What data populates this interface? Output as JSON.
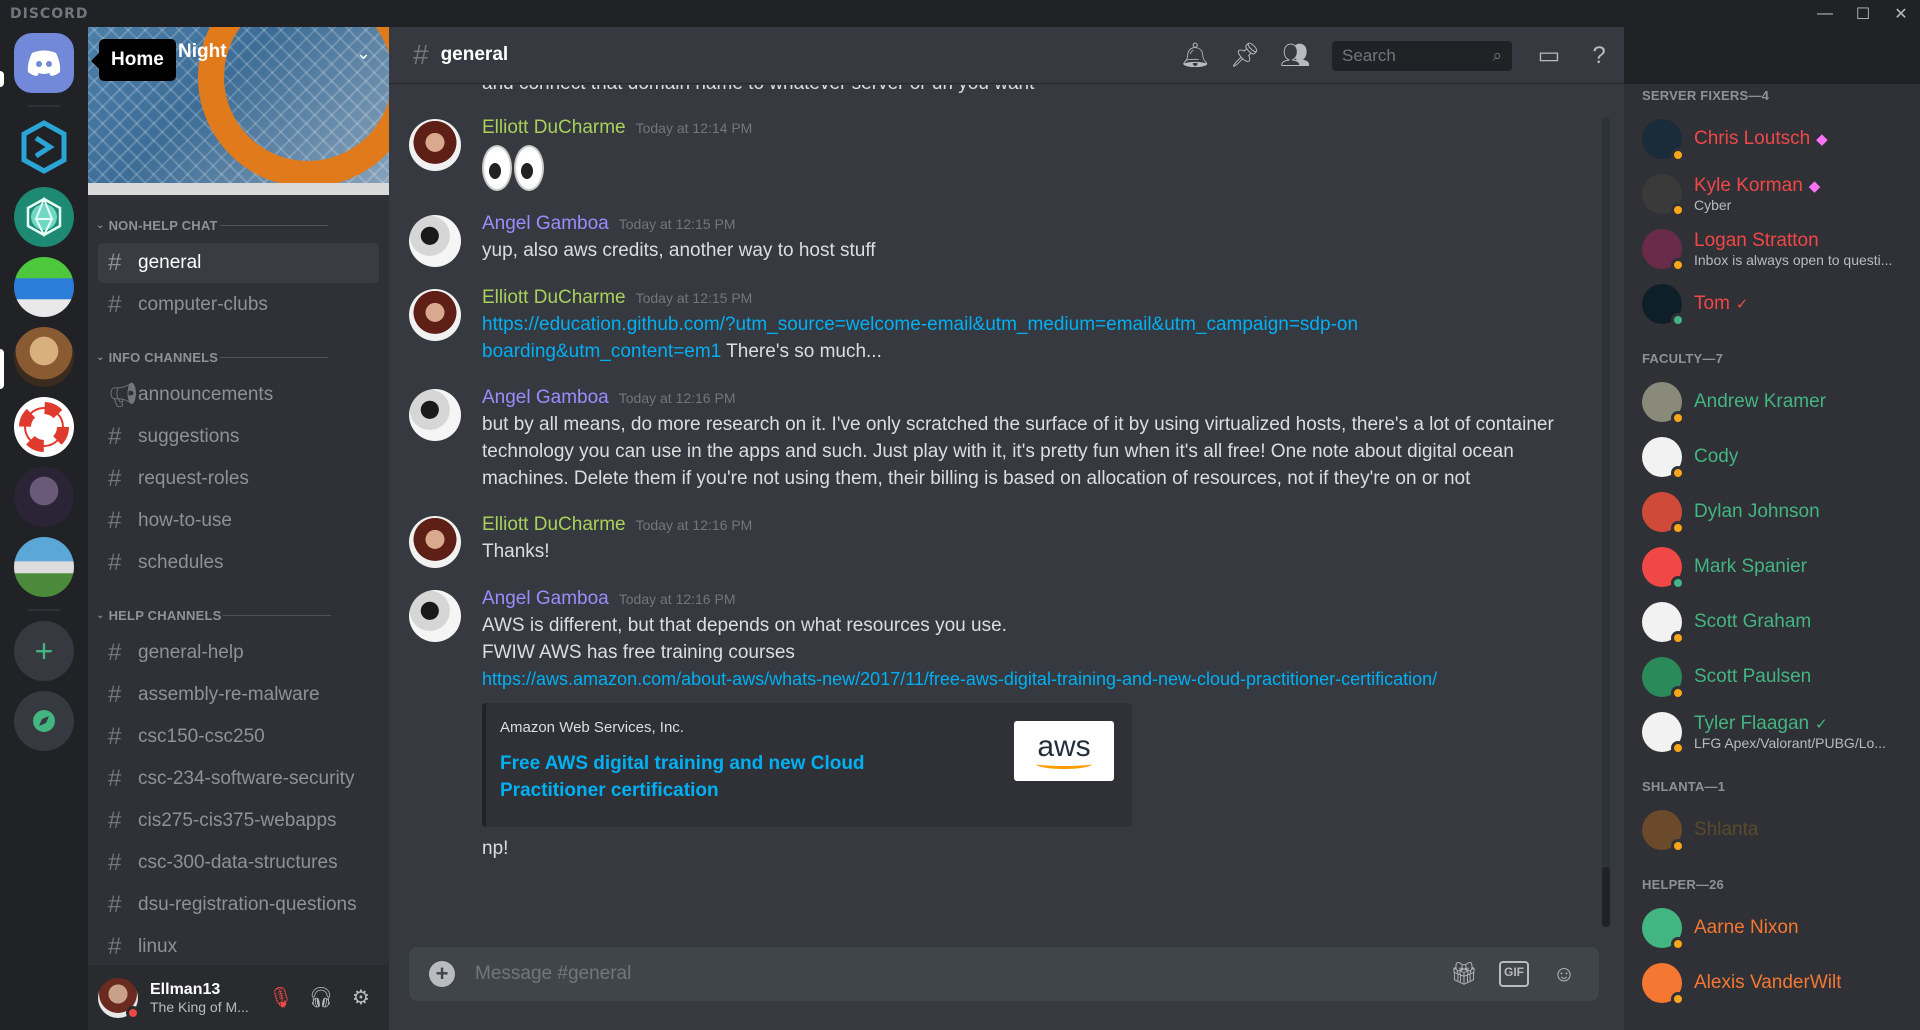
{
  "app": {
    "brand": "DISCORD"
  },
  "tooltip": {
    "label": "Home"
  },
  "server": {
    "name": "Night"
  },
  "channel_list": {
    "categories": [
      {
        "name": "NON-HELP CHAT",
        "channels": [
          "general",
          "computer-clubs"
        ]
      },
      {
        "name": "INFO CHANNELS",
        "channels": [
          "announcements",
          "suggestions",
          "request-roles",
          "how-to-use",
          "schedules"
        ]
      },
      {
        "name": "HELP CHANNELS",
        "channels": [
          "general-help",
          "assembly-re-malware",
          "csc150-csc250",
          "csc-234-software-security",
          "cis275-cis375-webapps",
          "csc-300-data-structures",
          "dsu-registration-questions",
          "linux"
        ]
      }
    ]
  },
  "user": {
    "name": "Ellman13",
    "status": "The King of M..."
  },
  "header": {
    "channel": "general",
    "search_placeholder": "Search"
  },
  "messages": {
    "fragment": "and connect that domain name to whatever server or url you want",
    "items": [
      {
        "author": "Elliott DuCharme",
        "time": "Today at 12:14 PM",
        "color": "#a8d15c",
        "body": ""
      },
      {
        "author": "Angel Gamboa",
        "time": "Today at 12:15 PM",
        "color": "#9b8cff",
        "body": "yup, also aws credits, another way to host stuff"
      },
      {
        "author": "Elliott DuCharme",
        "time": "Today at 12:15 PM",
        "color": "#a8d15c",
        "link": "https://education.github.com/?utm_source=welcome-email&utm_medium=email&utm_campaign=sdp-onboarding&utm_content=em1",
        "body": " There's so much..."
      },
      {
        "author": "Angel Gamboa",
        "time": "Today at 12:16 PM",
        "color": "#9b8cff",
        "body": "but by all means, do more research on it. I've only scratched the surface of it by using virtualized hosts, there's a lot of container technology you can use in the apps and such. Just play with it, it's pretty fun when it's all free! One note about digital ocean machines. Delete them if you're not using them, their billing is based on allocation of resources, not if they're on or not"
      },
      {
        "author": "Elliott DuCharme",
        "time": "Today at 12:16 PM",
        "color": "#a8d15c",
        "body": "Thanks!"
      },
      {
        "author": "Angel Gamboa",
        "time": "Today at 12:16 PM",
        "color": "#9b8cff",
        "line1": "AWS is different, but that depends on what resources you use.",
        "line2": "FWIW AWS has free training courses",
        "link": "https://aws.amazon.com/about-aws/whats-new/2017/11/free-aws-digital-training-and-new-cloud-practitioner-certification/",
        "after": "np!"
      }
    ],
    "embed": {
      "provider": "Amazon Web Services, Inc.",
      "title": "Free AWS digital training and new Cloud Practitioner certification",
      "thumb_text": "aws"
    }
  },
  "composer": {
    "placeholder": "Message #general",
    "gif_label": "GIF"
  },
  "members": {
    "groups": [
      {
        "title": "SERVER FIXERS—4",
        "items": [
          {
            "name": "Chris Loutsch",
            "sub": "",
            "color": "#f04747",
            "badge": "◆"
          },
          {
            "name": "Kyle Korman",
            "sub": "Cyber",
            "color": "#f04747",
            "badge": "◆"
          },
          {
            "name": "Logan Stratton",
            "sub": "Inbox is always open to questi...",
            "color": "#f04747",
            "badge": ""
          },
          {
            "name": "Tom",
            "sub": "",
            "color": "#f04747",
            "badge": "✓"
          }
        ]
      },
      {
        "title": "FACULTY—7",
        "items": [
          {
            "name": "Andrew Kramer",
            "sub": "",
            "color": "#43b581",
            "badge": ""
          },
          {
            "name": "Cody",
            "sub": "",
            "color": "#43b581",
            "badge": ""
          },
          {
            "name": "Dylan Johnson",
            "sub": "",
            "color": "#43b581",
            "badge": ""
          },
          {
            "name": "Mark Spanier",
            "sub": "",
            "color": "#43b581",
            "badge": ""
          },
          {
            "name": "Scott Graham",
            "sub": "",
            "color": "#43b581",
            "badge": ""
          },
          {
            "name": "Scott Paulsen",
            "sub": "",
            "color": "#43b581",
            "badge": ""
          },
          {
            "name": "Tyler Flaagan",
            "sub": "LFG Apex/Valorant/PUBG/Lo...",
            "color": "#43b581",
            "badge": "✓"
          }
        ]
      },
      {
        "title": "SHLANTA—1",
        "items": [
          {
            "name": "Shlanta",
            "sub": "",
            "color": "#5a4a2a",
            "badge": ""
          }
        ]
      },
      {
        "title": "HELPER—26",
        "items": [
          {
            "name": "Aarne Nixon",
            "sub": "",
            "color": "#f57731",
            "badge": ""
          },
          {
            "name": "Alexis VanderWilt",
            "sub": "",
            "color": "#f57731",
            "badge": ""
          }
        ]
      }
    ]
  },
  "colors": {
    "accent": "#7289da",
    "link": "#00b0f4",
    "online": "#43b581",
    "idle": "#faa61a",
    "dnd": "#f04747"
  }
}
